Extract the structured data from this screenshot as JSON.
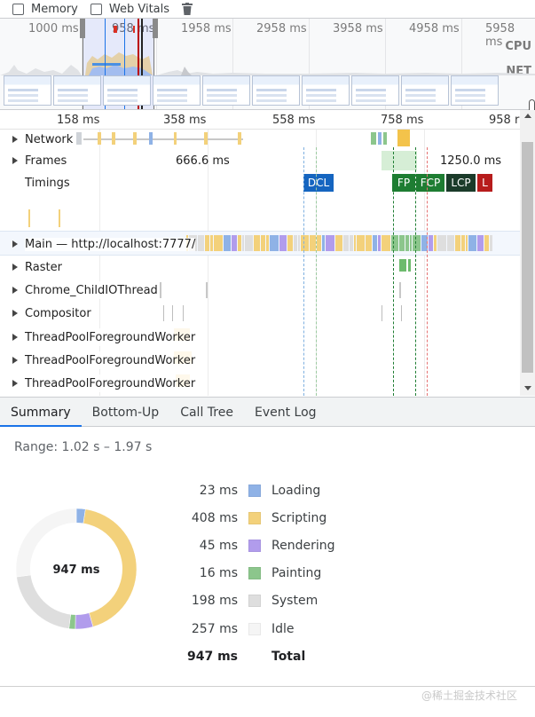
{
  "top_bar": {
    "memory_label": "Memory",
    "web_vitals_label": "Web Vitals"
  },
  "overview": {
    "ticks": [
      "1000 ms",
      "958 ms",
      "1958 ms",
      "2958 ms",
      "3958 ms",
      "4958 ms",
      "5958 ms"
    ],
    "cpu_label": "CPU",
    "net_label": "NET"
  },
  "ruler": {
    "ticks": [
      "158 ms",
      "358 ms",
      "558 ms",
      "758 ms",
      "958 r"
    ]
  },
  "tracks": {
    "network": "Network",
    "frames": "Frames",
    "frames_time_1": "666.6 ms",
    "frames_time_2": "1250.0 ms",
    "timings": "Timings",
    "main": "Main — http://localhost:7777/",
    "raster": "Raster",
    "child_io": "Chrome_ChildIOThread",
    "compositor": "Compositor",
    "pool1": "ThreadPoolForegroundWorker",
    "pool2": "ThreadPoolForegroundWorker",
    "pool3": "ThreadPoolForegroundWorker"
  },
  "markers": {
    "dcl": "DCL",
    "fp": "FP",
    "fcp": "FCP",
    "lcp": "LCP",
    "l": "L"
  },
  "tabs": [
    "Summary",
    "Bottom-Up",
    "Call Tree",
    "Event Log"
  ],
  "summary": {
    "range": "Range: 1.02 s – 1.97 s",
    "total_center": "947 ms",
    "items": [
      {
        "value": "23 ms",
        "label": "Loading",
        "color": "#8fb2e6",
        "ms": 23
      },
      {
        "value": "408 ms",
        "label": "Scripting",
        "color": "#f3d17b",
        "ms": 408
      },
      {
        "value": "45 ms",
        "label": "Rendering",
        "color": "#b19cec",
        "ms": 45
      },
      {
        "value": "16 ms",
        "label": "Painting",
        "color": "#8cc68c",
        "ms": 16
      },
      {
        "value": "198 ms",
        "label": "System",
        "color": "#dedede",
        "ms": 198
      },
      {
        "value": "257 ms",
        "label": "Idle",
        "color": "#f5f5f5",
        "ms": 257
      }
    ],
    "total_value": "947 ms",
    "total_label": "Total"
  },
  "footer": {
    "watermark": "@稀土掘金技术社区"
  },
  "colors": {
    "scripting": "#f3d17b",
    "rendering": "#b19cec",
    "painting": "#8cc68c",
    "system": "#dedede",
    "loading": "#8fb2e6",
    "dcl": "#1565c0",
    "fp_fcp": "#1e7d32",
    "lcp": "#1b3b2a",
    "l": "#b71c1c",
    "tab_active": "#1a73e8"
  }
}
